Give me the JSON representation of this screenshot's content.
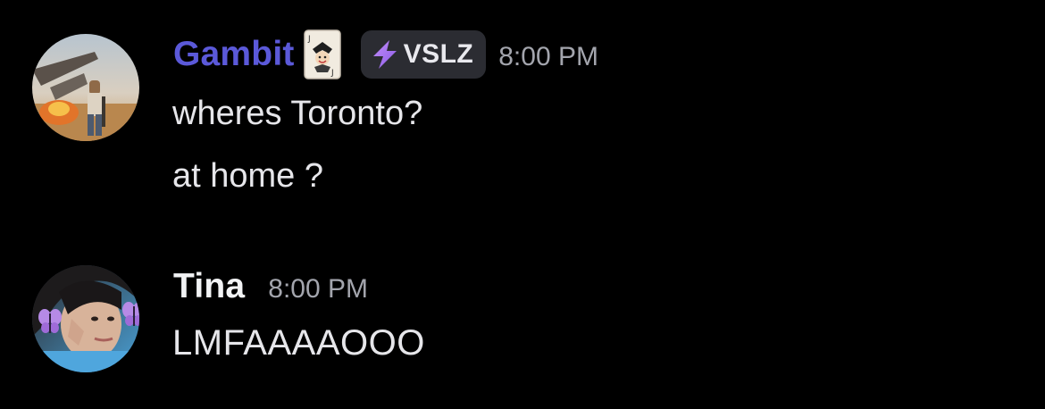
{
  "messages": [
    {
      "username": "Gambit",
      "username_color": "#5b59d9",
      "name_emoji": "joker-card-icon",
      "role_badge": {
        "icon": "lightning-bolt-icon",
        "label": "VSLZ"
      },
      "timestamp": "8:00 PM",
      "avatar": "gambit-avatar",
      "lines": [
        "wheres Toronto?",
        "at home ?"
      ]
    },
    {
      "username": "Tina",
      "username_color": "#f2f3f5",
      "timestamp": "8:00 PM",
      "avatar": "tina-avatar",
      "lines": [
        "LMFAAAAOOO"
      ]
    }
  ]
}
